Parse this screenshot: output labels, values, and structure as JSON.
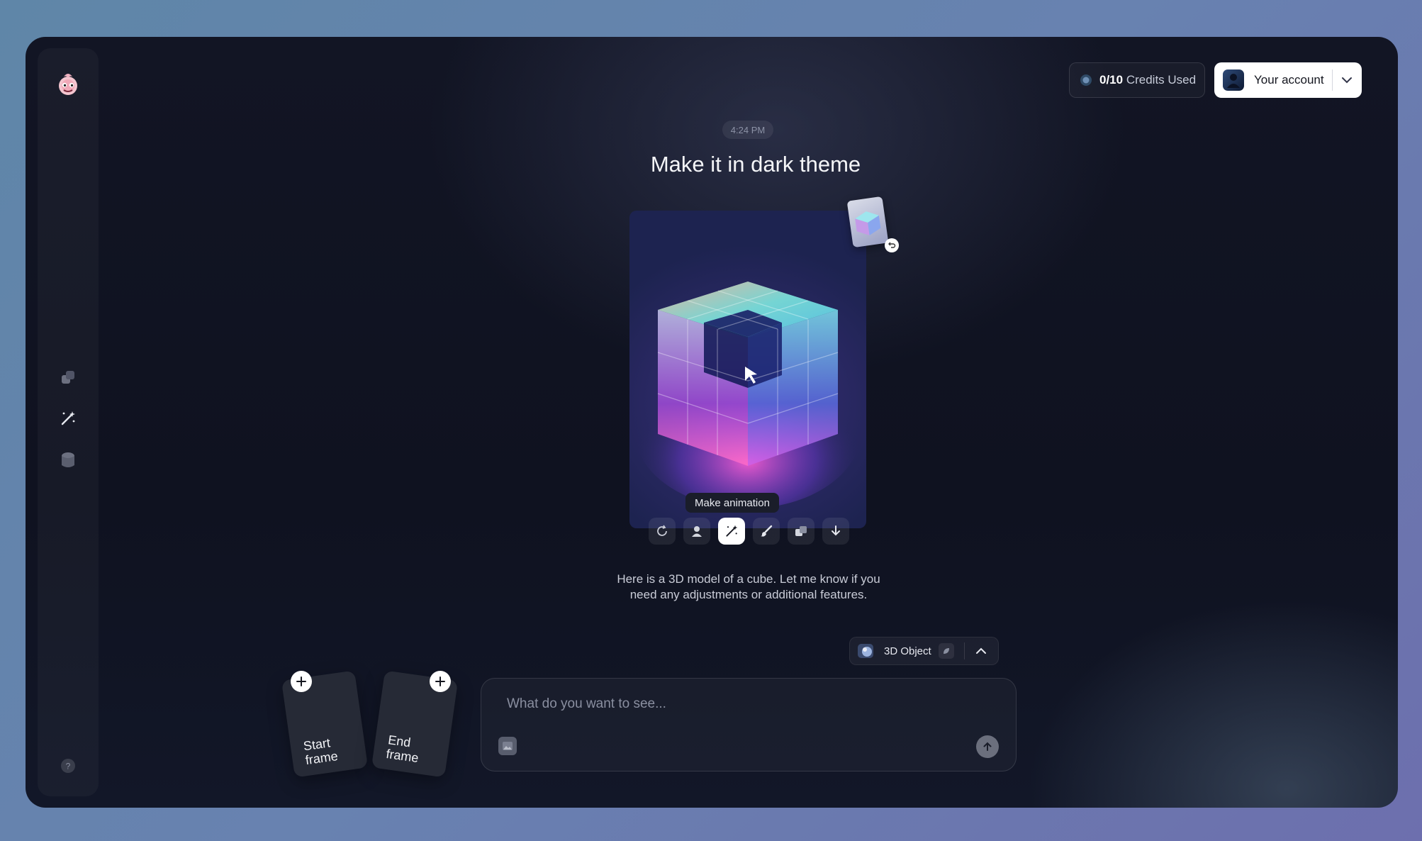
{
  "header": {
    "credits_used": "0/10",
    "credits_label": "Credits Used",
    "account_label": "Your account"
  },
  "chat": {
    "timestamp": "4:24 PM",
    "prompt_title": "Make it in dark theme",
    "tooltip": "Make animation",
    "reply_line1": "Here is a 3D model of a cube. Let me know if you",
    "reply_line2": "need any adjustments or additional features."
  },
  "toolbar": {
    "actions": [
      "regenerate-icon",
      "character-icon",
      "magic-wand-icon",
      "brush-icon",
      "layers-icon",
      "download-icon"
    ],
    "active": "magic-wand-icon"
  },
  "mode": {
    "label": "3D Object"
  },
  "frames": {
    "start_label_1": "Start",
    "start_label_2": "frame",
    "end_label_1": "End",
    "end_label_2": "frame"
  },
  "composer": {
    "placeholder": "What do you want to see..."
  },
  "colors": {
    "background": "#121524",
    "accent_white": "#ffffff",
    "muted_text": "#8a8fa0"
  }
}
